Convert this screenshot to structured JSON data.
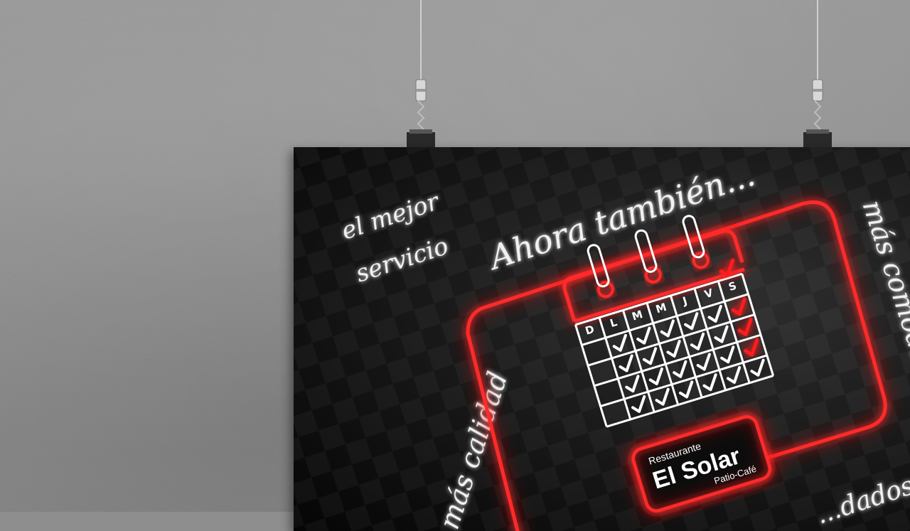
{
  "poster": {
    "headline": "Ahora también...",
    "phrase_top_left_1": "el mejor",
    "phrase_top_left_2": "servicio",
    "phrase_left": "más calidad",
    "phrase_right": "más comodidad",
    "phrase_bottom_right": "...dados",
    "calendar": {
      "days": [
        "D",
        "L",
        "M",
        "M",
        "J",
        "V",
        "S"
      ],
      "neon_color": "#ff2a2a",
      "check_color_regular": "#ffffff",
      "check_color_highlight": "#ff1a1a"
    },
    "logo": {
      "top_line": "Restaurante",
      "main": "El Solar",
      "sub": "Patio-Café"
    }
  }
}
